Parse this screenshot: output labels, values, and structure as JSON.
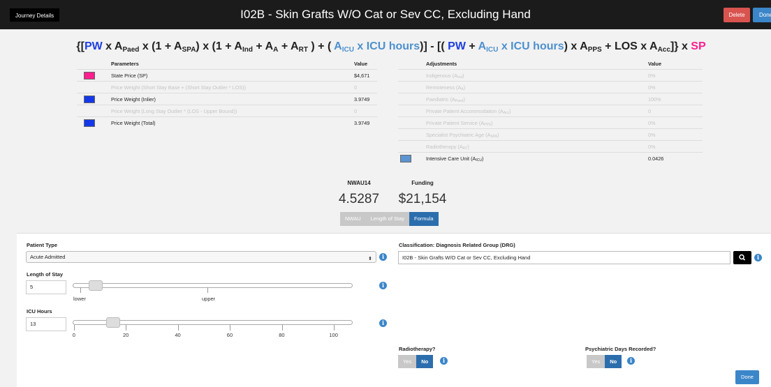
{
  "header": {
    "journey_btn": "Journey Details",
    "title": "I02B - Skin Grafts W/O Cat or Sev CC, Excluding Hand",
    "delete_label": "Delete",
    "done_label": "Done"
  },
  "formula": {
    "p1": "{[",
    "pw": "PW",
    "p2": " x A",
    "paed": "Paed",
    "p3": " x (1 + A",
    "spa": "SPA",
    "p4": ") x (1 + A",
    "ind": "Ind",
    "p5": " + A",
    "a": "A",
    "p6": " + A",
    "rt": "RT",
    "p7": " ) + ( ",
    "aicu1": "A",
    "icu1": "ICU",
    "icuh1": " x ICU hours",
    "p8": ")] - [( ",
    "pw2": "PW",
    "p9": " + ",
    "aicu2": "A",
    "icu2": "ICU",
    "icuh2": " x ICU hours",
    "p10": ") x A",
    "pps": "PPS",
    "p11": " + LOS x A",
    "acc": "Acc",
    "p12": "]} x ",
    "sp": "SP"
  },
  "parameters": {
    "header_name": "Parameters",
    "header_value": "Value",
    "rows": [
      {
        "label": "State Price (SP)",
        "value": "$4,671",
        "color": "#ff1f8e"
      },
      {
        "label": "Price Weight (Short Stay Base + (Short Stay Outlier * LOS))",
        "value": "0"
      },
      {
        "label": "Price Weight (Inlier)",
        "value": "3.9749",
        "color": "#1438e8"
      },
      {
        "label": "Price Weight (Long Stay Outlier * (LOS - Upper Bound))",
        "value": "0"
      },
      {
        "label": "Price Weight (Total)",
        "value": "3.9749",
        "color": "#1438e8"
      }
    ]
  },
  "adjustments": {
    "header_name": "Adjustments",
    "header_value": "Value",
    "rows": [
      {
        "label": "Indigenous (A",
        "sub": "Ind",
        "tail": ")",
        "value": "0%"
      },
      {
        "label": "Remoteness (A",
        "sub": "A",
        "tail": ")",
        "value": "0%"
      },
      {
        "label": "Paediatric (A",
        "sub": "Paed",
        "tail": ")",
        "value": "100%"
      },
      {
        "label": "Private Patient Accommodation (A",
        "sub": "Acc",
        "tail": ")",
        "value": "0"
      },
      {
        "label": "Private Patient Service (A",
        "sub": "PPS",
        "tail": ")",
        "value": "0%"
      },
      {
        "label": "Specialist Psychiatric Age (A",
        "sub": "SPA",
        "tail": ")",
        "value": "0%"
      },
      {
        "label": "Radiotherapy (A",
        "sub": "RT",
        "tail": ")",
        "value": "0%"
      },
      {
        "label": "Intensive Care Unit (A",
        "sub": "ICU",
        "tail": ")",
        "value": "0.0426",
        "color": "#5b94d0"
      }
    ]
  },
  "summary": {
    "nwau_label": "NWAU14",
    "nwau_value": "4.5287",
    "funding_label": "Funding",
    "funding_value": "$21,154"
  },
  "tabs": [
    "NWAU",
    "Length of Stay",
    "Formula"
  ],
  "form": {
    "patient_type_label": "Patient Type",
    "patient_type_value": "Acute Admitted",
    "los_label": "Length of Stay",
    "los_value": "5",
    "los_lower": "lower",
    "los_upper": "upper",
    "icu_label": "ICU Hours",
    "icu_value": "13",
    "icu_ticks": [
      "0",
      "20",
      "40",
      "60",
      "80",
      "100"
    ],
    "icu_slider_value": 13,
    "drg_label": "Classification: Diagnosis Related Group (DRG)",
    "drg_value": "I02B - Skin Grafts W/O Cat or Sev CC, Excluding Hand",
    "radio_label": "Radiotherapy?",
    "psych_label": "Psychiatric Days Recorded?",
    "yes": "Yes",
    "no": "No",
    "done_label": "Done"
  }
}
